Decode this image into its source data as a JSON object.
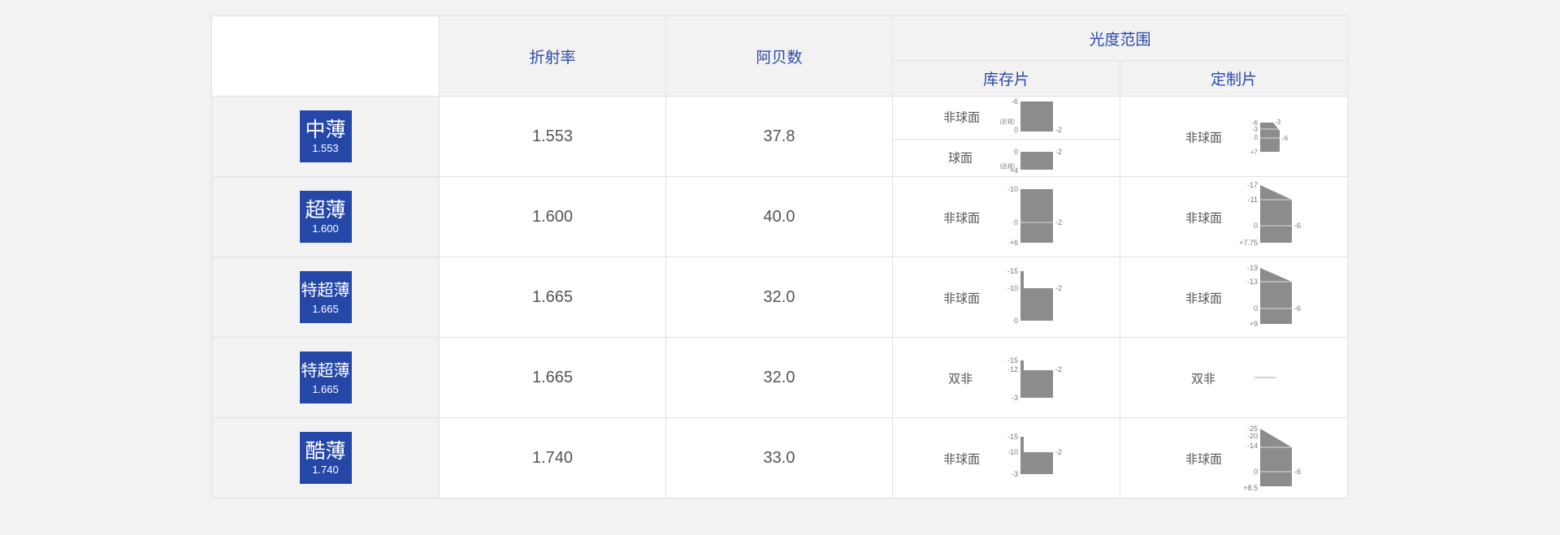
{
  "header": {
    "refractive_index": "折射率",
    "abbe_number": "阿贝数",
    "power_range": "光度范围",
    "stock_lens": "库存片",
    "custom_lens": "定制片"
  },
  "rows": [
    {
      "name": "中薄",
      "index_badge": "1.553",
      "refractive_index": "1.553",
      "abbe_number": "37.8",
      "stock": [
        {
          "type": "非球面",
          "top": "-6",
          "right": "-2",
          "bottom": "0",
          "note": "(近视)"
        },
        {
          "type": "球面",
          "top": "0",
          "right": "-2",
          "bottom": "+4",
          "note": "(远视)"
        }
      ],
      "custom": {
        "type": "非球面",
        "labels_left": [
          "-6",
          "-3",
          "0",
          "+7"
        ],
        "label_top_right": "-3",
        "label_right": "-6"
      }
    },
    {
      "name": "超薄",
      "index_badge": "1.600",
      "refractive_index": "1.600",
      "abbe_number": "40.0",
      "stock": [
        {
          "type": "非球面",
          "labels_left": [
            "-10",
            "0",
            "+6"
          ],
          "label_right": "-2"
        }
      ],
      "custom": {
        "type": "非球面",
        "labels_left": [
          "-17",
          "-11",
          "0",
          "+7.75"
        ],
        "label_right": "-6"
      }
    },
    {
      "name": "特超薄",
      "index_badge": "1.665",
      "refractive_index": "1.665",
      "abbe_number": "32.0",
      "stock": [
        {
          "type": "非球面",
          "labels_left": [
            "-15",
            "-10",
            "0"
          ],
          "label_right": "-2"
        }
      ],
      "custom": {
        "type": "非球面",
        "labels_left": [
          "-19",
          "-13",
          "0",
          "+9"
        ],
        "label_right": "-6"
      }
    },
    {
      "name": "特超薄",
      "index_badge": "1.665",
      "refractive_index": "1.665",
      "abbe_number": "32.0",
      "stock": [
        {
          "type": "双非",
          "labels_left": [
            "-15",
            "-12",
            "-3"
          ],
          "label_right": "-2"
        }
      ],
      "custom": {
        "type": "双非",
        "dash": "——"
      }
    },
    {
      "name": "酷薄",
      "index_badge": "1.740",
      "refractive_index": "1.740",
      "abbe_number": "33.0",
      "stock": [
        {
          "type": "非球面",
          "labels_left": [
            "-15",
            "-10",
            "-3"
          ],
          "label_right": "-2"
        }
      ],
      "custom": {
        "type": "非球面",
        "labels_left": [
          "-25",
          "-20",
          "-14",
          "0",
          "+8.5"
        ],
        "label_right": "-6"
      }
    }
  ],
  "colors": {
    "badge": "#2447a8",
    "header_text": "#2b4aa8",
    "bar": "#8c8c8c"
  }
}
